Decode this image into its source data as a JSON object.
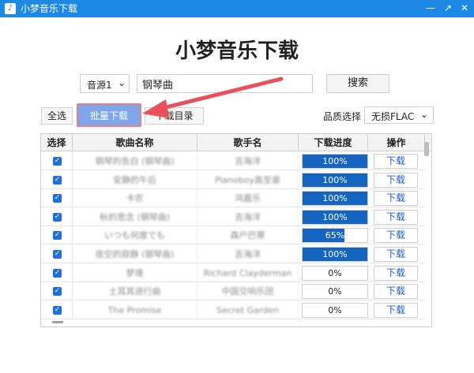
{
  "window": {
    "title": "小梦音乐下载",
    "controls": [
      "—",
      "↗",
      "✕"
    ]
  },
  "app": {
    "heading": "小梦音乐下载"
  },
  "search": {
    "source": "音源1",
    "query": "钢琴曲",
    "button": "搜索"
  },
  "actions": {
    "select_all": "全选",
    "batch_download": "批量下载",
    "download_dir": "下载目录",
    "quality_label": "品质选择",
    "quality_value": "无损FLAC"
  },
  "table": {
    "headers": [
      "选择",
      "歌曲名称",
      "歌手名",
      "下载进度",
      "操作"
    ],
    "rows": [
      {
        "song": "钢琴的告白 (钢琴曲)",
        "artist": "吉海洋",
        "progress": 100,
        "progress_text": "100%",
        "action": "下载"
      },
      {
        "song": "安静的午后",
        "artist": "Pianoboy高至豪",
        "progress": 100,
        "progress_text": "100%",
        "action": "下载"
      },
      {
        "song": "卡农",
        "artist": "鸿嘉乐",
        "progress": 100,
        "progress_text": "100%",
        "action": "下载"
      },
      {
        "song": "秋的思念 (钢琴曲)",
        "artist": "吉海洋",
        "progress": 100,
        "progress_text": "100%",
        "action": "下载"
      },
      {
        "song": "いつも何度でも",
        "artist": "森户巴蒂",
        "progress": 65,
        "progress_text": "65%",
        "action": "下载"
      },
      {
        "song": "夜空的寂静 (钢琴曲)",
        "artist": "吉海洋",
        "progress": 100,
        "progress_text": "100%",
        "action": "下载"
      },
      {
        "song": "梦境",
        "artist": "Richard Clayderman",
        "progress": 0,
        "progress_text": "0%",
        "action": "下载"
      },
      {
        "song": "土耳其进行曲",
        "artist": "中国交响乐团",
        "progress": 0,
        "progress_text": "0%",
        "action": "下载"
      },
      {
        "song": "The Promise",
        "artist": "Secret Garden",
        "progress": 0,
        "progress_text": "0%",
        "action": "下载"
      }
    ]
  },
  "colors": {
    "titlebar": "#1e88e5",
    "progress_fill": "#1565c0",
    "batch_button": "#7da7ea",
    "annotation_arrow": "#e8505b"
  }
}
